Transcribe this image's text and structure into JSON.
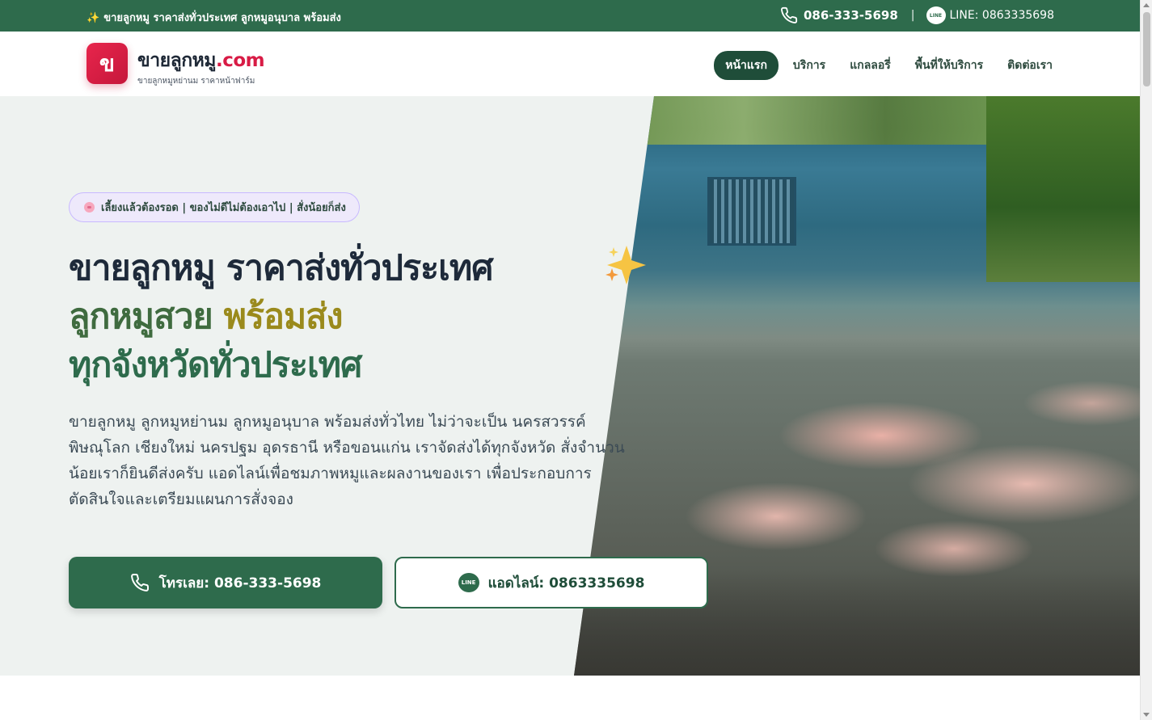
{
  "topbar": {
    "announcement_icon": "sparkles-icon",
    "announcement": "ขายลูกหมู ราคาส่งทั่วประเทศ ลูกหมูอนุบาล พร้อมส่ง",
    "phone": "086-333-5698",
    "separator": "|",
    "line_badge": "LINE",
    "line_label": "LINE: 0863335698"
  },
  "header": {
    "logo_letter": "ข",
    "brand_name": "ขายลูกหมู",
    "brand_tld": ".com",
    "brand_tagline": "ขายลูกหมูหย่านม ราคาหน้าฟาร์ม",
    "nav": [
      {
        "label": "หน้าแรก",
        "active": true
      },
      {
        "label": "บริการ",
        "active": false
      },
      {
        "label": "แกลลอรี่",
        "active": false
      },
      {
        "label": "พื้นที่ให้บริการ",
        "active": false
      },
      {
        "label": "ติดต่อเรา",
        "active": false
      }
    ]
  },
  "hero": {
    "pill": "เลี้ยงแล้วต้องรอด | ของไม่ดีไม่ต้องเอาไป | สั่งน้อยก็ส่ง",
    "title_line1": "ขายลูกหมู ราคาส่งทั่วประเทศ",
    "title_line2_a": "ลูกหมูสวย",
    "title_line2_b": "พร้อมส่ง",
    "title_line3": "ทุกจังหวัดทั่วประเทศ",
    "description": "ขายลูกหมู ลูกหมูหย่านม ลูกหมูอนุบาล พร้อมส่งทั่วไทย ไม่ว่าจะเป็น นครสวรรค์ พิษณุโลก เชียงใหม่ นครปฐม อุดรธานี หรือขอนแก่น เราจัดส่งได้ทุกจังหวัด สั่งจำนวนน้อยเราก็ยินดีส่งครับ แอดไลน์เพื่อชมภาพหมูและผลงานของเรา เพื่อประกอบการตัดสินใจและเตรียมแผนการสั่งจอง",
    "call_button": "โทรเลย: 086-333-5698",
    "line_button": "แอดไลน์: 0863335698",
    "line_badge": "LINE"
  },
  "colors": {
    "primary_green": "#2e6b4c",
    "dark_green": "#1f4d39",
    "brand_red": "#d81b45",
    "pill_border": "#c8b9ff",
    "hero_bg": "#eef2f0"
  }
}
